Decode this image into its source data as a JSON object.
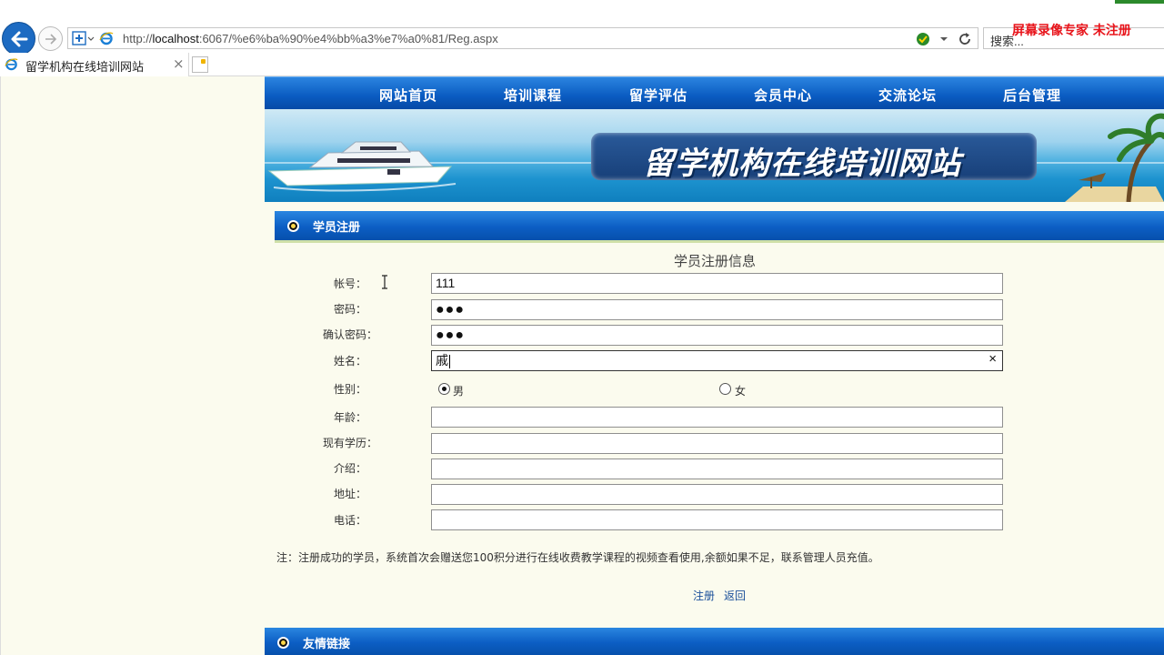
{
  "browser": {
    "url_prefix": "http://",
    "url_host": "localhost",
    "url_rest": ":6067/%e6%ba%90%e4%bb%a3%e7%a0%81/Reg.aspx",
    "search_label": "搜索...",
    "tab_title": "留学机构在线培训网站",
    "tab_close": "×",
    "watermark": "屏幕录像专家 未注册"
  },
  "nav": {
    "items": [
      "网站首页",
      "培训课程",
      "留学评估",
      "会员中心",
      "交流论坛",
      "后台管理"
    ]
  },
  "banner": {
    "site_title": "留学机构在线培训网站"
  },
  "section": {
    "register_title": "学员注册",
    "links_title": "友情链接"
  },
  "form": {
    "title": "学员注册信息",
    "fields": [
      {
        "label": "帐号：",
        "value": "111"
      },
      {
        "label": "密码：",
        "value": "●●●"
      },
      {
        "label": "确认密码：",
        "value": "●●●"
      },
      {
        "label": "姓名：",
        "value": "戚"
      },
      {
        "label": "性别："
      },
      {
        "label": "年龄：",
        "value": ""
      },
      {
        "label": "现有学历：",
        "value": ""
      },
      {
        "label": "介绍：",
        "value": ""
      },
      {
        "label": "地址：",
        "value": ""
      },
      {
        "label": "电话：",
        "value": ""
      }
    ],
    "gender_options": [
      {
        "label": "男",
        "selected": true
      },
      {
        "label": "女",
        "selected": false
      }
    ],
    "clear_button": "×",
    "note": "注：注册成功的学员，系统首次会赠送您100积分进行在线收费教学课程的视频查看使用,余额如果不足，联系管理人员充值。",
    "submit_label": "注册",
    "back_label": "返回"
  },
  "colors": {
    "nav_blue": "#0a5bc1",
    "page_bg": "#fbfbee",
    "link_blue": "#1a4f9a",
    "watermark_red": "#e8141b"
  }
}
